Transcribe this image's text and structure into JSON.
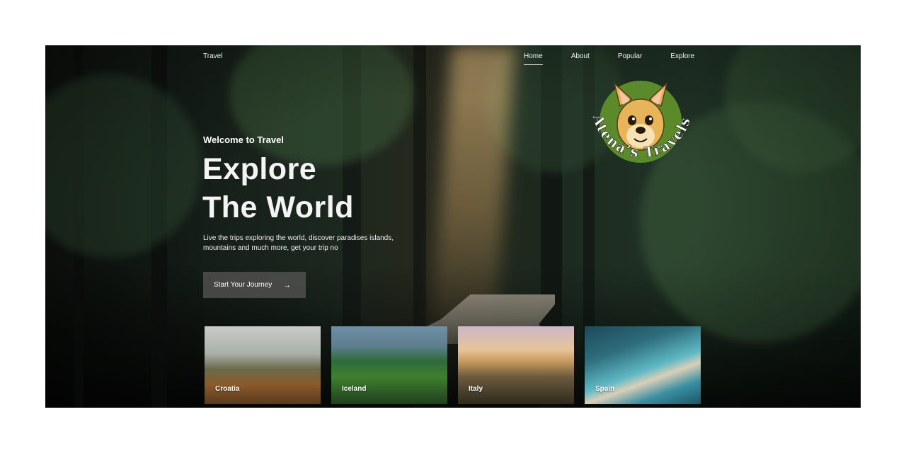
{
  "nav": {
    "brand": "Travel",
    "items": [
      {
        "label": "Home",
        "active": true
      },
      {
        "label": "About"
      },
      {
        "label": "Popular"
      },
      {
        "label": "Explore"
      }
    ]
  },
  "hero": {
    "welcome": "Welcome to Travel",
    "headline_line1": "Explore",
    "headline_line2": "The World",
    "description": "Live the trips exploring the world, discover paradises islands, mountains and much more, get your trip no",
    "cta_label": "Start Your Journey",
    "cta_icon": "arrow-right-icon"
  },
  "logo": {
    "text": "Atena’s Travels",
    "icon": "dog-face-icon",
    "colors": {
      "circle": "#5b8a2a",
      "dog": "#e8b45a",
      "text": "#ffffff"
    }
  },
  "destinations": [
    {
      "label": "Croatia"
    },
    {
      "label": "Iceland"
    },
    {
      "label": "Italy"
    },
    {
      "label": "Spain"
    }
  ],
  "colors": {
    "page_background": "#ffffff",
    "hero_dark": "#101510",
    "button_bg": "#50504e",
    "text": "#ffffff"
  }
}
